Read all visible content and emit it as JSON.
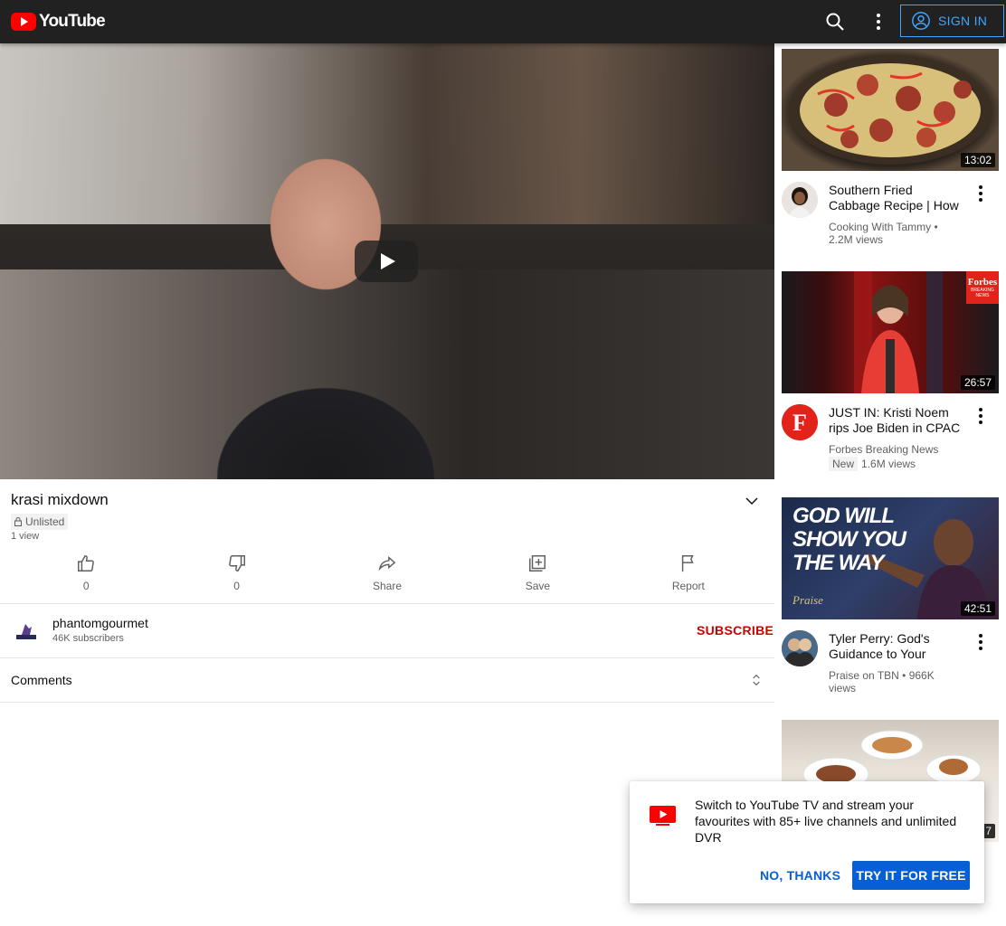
{
  "header": {
    "brand": "YouTube",
    "sign_in_label": "SIGN IN"
  },
  "video": {
    "title": "krasi mixdown",
    "visibility": "Unlisted",
    "views": "1 view"
  },
  "actions": [
    {
      "label": "0"
    },
    {
      "label": "0"
    },
    {
      "label": "Share"
    },
    {
      "label": "Save"
    },
    {
      "label": "Report"
    }
  ],
  "channel": {
    "name": "phantomgourmet",
    "subscribers": "46K subscribers",
    "subscribe_label": "SUBSCRIBE"
  },
  "comments": {
    "label": "Comments"
  },
  "related": [
    {
      "title": "Southern Fried Cabbage Recipe | How",
      "channel": "Cooking With Tammy",
      "meta": "2.2M views",
      "duration": "13:02"
    },
    {
      "title": "JUST IN: Kristi Noem rips Joe Biden in CPAC",
      "channel": "Forbes Breaking News",
      "badge": "New",
      "meta": "1.6M views",
      "duration": "26:57",
      "thumb_badge": "Forbes",
      "thumb_badge_sub": "BREAKING NEWS"
    },
    {
      "title": "Tyler Perry: God's Guidance to Your",
      "channel": "Praise on TBN",
      "meta": "966K views",
      "duration": "42:51",
      "thumb_text": "GOD WILL SHOW YOU THE WAY",
      "thumb_logo": "Praise"
    },
    {
      "duration": "7"
    }
  ],
  "promo": {
    "text": "Switch to YouTube TV and stream your favourites with 85+ live channels and unlimited DVR",
    "decline_label": "NO, THANKS",
    "accept_label": "TRY IT FOR FREE"
  },
  "colors": {
    "header_bg": "#212121",
    "brand_red": "#ff0000",
    "sign_in_blue": "#3ea6ff",
    "subscribe_red": "#cc0000",
    "action_blue": "#065fd4"
  }
}
